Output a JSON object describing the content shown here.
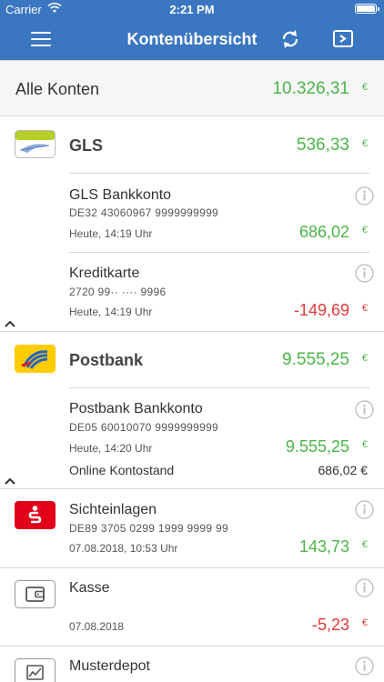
{
  "status": {
    "carrier": "Carrier",
    "time": "2:21 PM"
  },
  "nav": {
    "title": "Kontenübersicht"
  },
  "summary": {
    "label": "Alle Konten",
    "amount": "10.326,31",
    "currency": "€"
  },
  "currency": "€",
  "banks": [
    {
      "name": "GLS",
      "total": "536,33",
      "icon": "gls-bank-icon",
      "accounts": [
        {
          "name": "GLS Bankkonto",
          "iban": "DE32 43060967 9999999999",
          "time": "Heute, 14:19 Uhr",
          "balance": "686,02"
        },
        {
          "name": "Kreditkarte",
          "iban": "2720 99·· ···· 9996",
          "time": "Heute, 14:19 Uhr",
          "balance": "-149,69"
        }
      ]
    },
    {
      "name": "Postbank",
      "total": "9.555,25",
      "icon": "postbank-icon",
      "accounts": [
        {
          "name": "Postbank Bankkonto",
          "iban": "DE05 60010070 9999999999",
          "time": "Heute, 14:20 Uhr",
          "balance": "9.555,25",
          "online_label": "Online Kontostand",
          "online_value": "686,02 €"
        }
      ]
    }
  ],
  "singles": [
    {
      "name": "Sichteinlagen",
      "iban": "DE89 3705 0299 1999 9999 99",
      "time": "07.08.2018, 10:53 Uhr",
      "balance": "143,73",
      "icon": "sparkasse-icon"
    },
    {
      "name": "Kasse",
      "time": "07.08.2018",
      "balance": "-5,23",
      "icon": "wallet-icon"
    },
    {
      "name": "Musterdepot",
      "icon": "chart-icon"
    }
  ],
  "colors": {
    "navbar": "#3b76c1",
    "positive": "#4cb548",
    "negative": "#e03a3a"
  }
}
